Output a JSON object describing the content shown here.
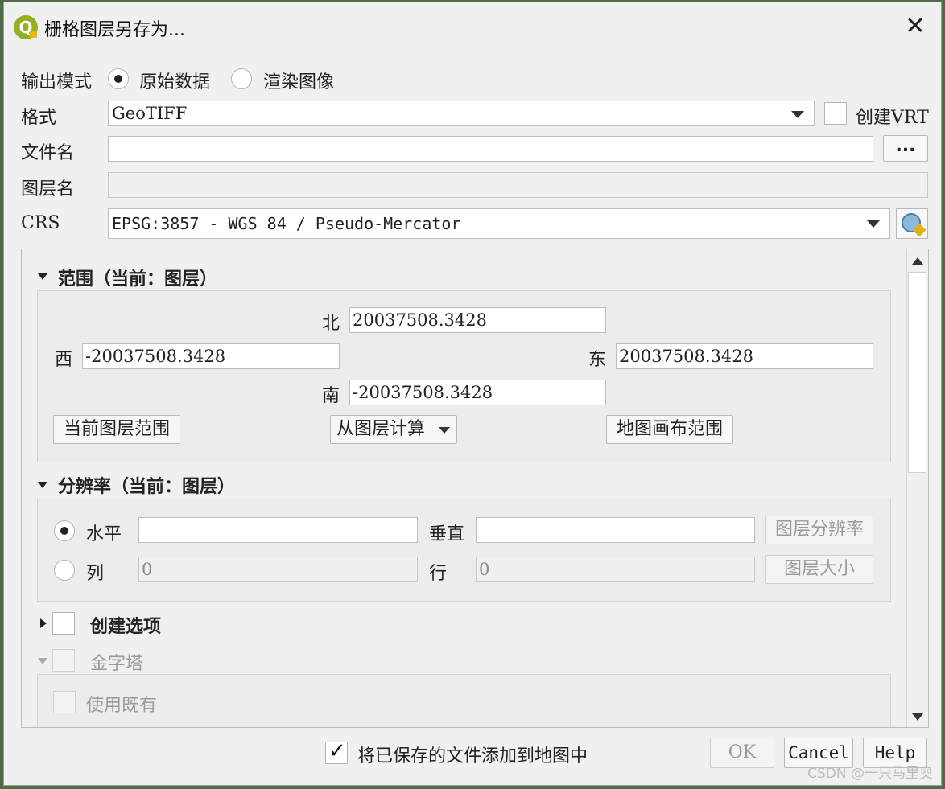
{
  "window": {
    "title": "栅格图层另存为..."
  },
  "output_mode": {
    "label": "输出模式",
    "option_raw": "原始数据",
    "option_render": "渲染图像"
  },
  "format": {
    "label": "格式",
    "value": "GeoTIFF",
    "create_vrt_label": "创建VRT"
  },
  "filename": {
    "label": "文件名",
    "value": "",
    "browse": "..."
  },
  "layername": {
    "label": "图层名",
    "value": ""
  },
  "crs": {
    "label": "CRS",
    "value": "EPSG:3857 - WGS 84 / Pseudo-Mercator"
  },
  "extent": {
    "heading": "范围（当前：图层）",
    "north_label": "北",
    "north": "20037508.3428",
    "west_label": "西",
    "west": "-20037508.3428",
    "east_label": "东",
    "east": "20037508.3428",
    "south_label": "南",
    "south": "-20037508.3428",
    "btn_current_layer": "当前图层范围",
    "btn_calc_from_layer": "从图层计算",
    "btn_map_canvas": "地图画布范围"
  },
  "resolution": {
    "heading": "分辨率（当前：图层）",
    "horizontal_label": "水平",
    "horizontal": "",
    "vertical_label": "垂直",
    "vertical": "",
    "btn_layer_resolution": "图层分辨率",
    "columns_label": "列",
    "columns": "0",
    "rows_label": "行",
    "rows": "0",
    "btn_layer_size": "图层大小"
  },
  "create_options": {
    "heading": "创建选项"
  },
  "pyramids": {
    "heading": "金字塔",
    "use_existing": "使用既有"
  },
  "footer": {
    "add_to_map_label": "将已保存的文件添加到地图中",
    "ok": "OK",
    "cancel": "Cancel",
    "help": "Help"
  },
  "watermark": "CSDN @一只马里奥"
}
